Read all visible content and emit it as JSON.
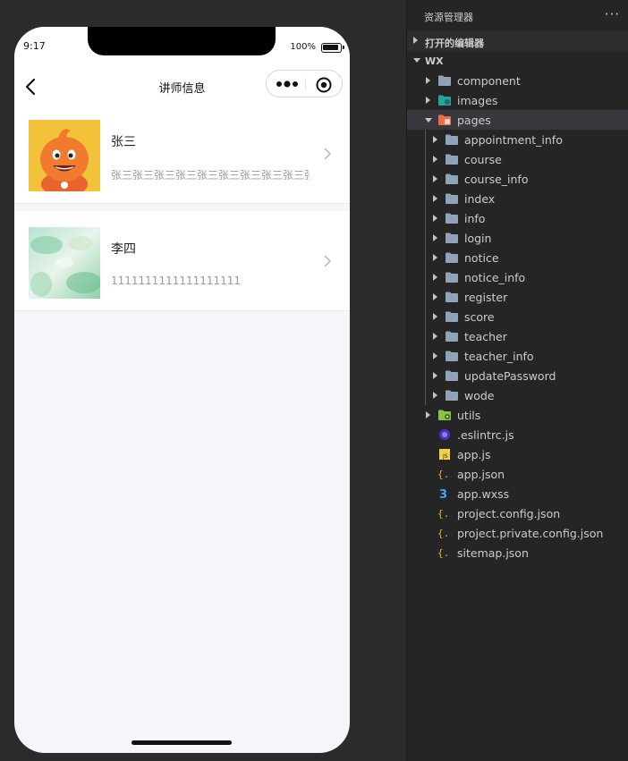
{
  "phone": {
    "status": {
      "time": "9:17",
      "battery": "100%"
    },
    "nav": {
      "title": "讲师信息"
    },
    "teachers": [
      {
        "name": "张三",
        "description": "张三张三张三张三张三张三张三张三张三张三张三"
      },
      {
        "name": "李四",
        "description": "1111111111111111111"
      }
    ]
  },
  "explorer": {
    "title": "资源管理器",
    "more": "···",
    "open_editors": "打开的编辑器",
    "root": "WX",
    "items": [
      {
        "label": "component",
        "icon": "folder-icon",
        "kind": "folder",
        "depth": 1,
        "open": false
      },
      {
        "label": "images",
        "icon": "images-folder-icon",
        "kind": "folder",
        "depth": 1,
        "open": false
      },
      {
        "label": "pages",
        "icon": "pages-folder-icon",
        "kind": "folder",
        "depth": 1,
        "open": true,
        "selected": true
      },
      {
        "label": "appointment_info",
        "icon": "folder-icon",
        "kind": "folder",
        "depth": 2,
        "open": false
      },
      {
        "label": "course",
        "icon": "folder-icon",
        "kind": "folder",
        "depth": 2,
        "open": false
      },
      {
        "label": "course_info",
        "icon": "folder-icon",
        "kind": "folder",
        "depth": 2,
        "open": false
      },
      {
        "label": "index",
        "icon": "folder-icon",
        "kind": "folder",
        "depth": 2,
        "open": false
      },
      {
        "label": "info",
        "icon": "folder-icon",
        "kind": "folder",
        "depth": 2,
        "open": false
      },
      {
        "label": "login",
        "icon": "folder-icon",
        "kind": "folder",
        "depth": 2,
        "open": false
      },
      {
        "label": "notice",
        "icon": "folder-icon",
        "kind": "folder",
        "depth": 2,
        "open": false
      },
      {
        "label": "notice_info",
        "icon": "folder-icon",
        "kind": "folder",
        "depth": 2,
        "open": false
      },
      {
        "label": "register",
        "icon": "folder-icon",
        "kind": "folder",
        "depth": 2,
        "open": false
      },
      {
        "label": "score",
        "icon": "folder-icon",
        "kind": "folder",
        "depth": 2,
        "open": false
      },
      {
        "label": "teacher",
        "icon": "folder-icon",
        "kind": "folder",
        "depth": 2,
        "open": false
      },
      {
        "label": "teacher_info",
        "icon": "folder-icon",
        "kind": "folder",
        "depth": 2,
        "open": false
      },
      {
        "label": "updatePassword",
        "icon": "folder-icon",
        "kind": "folder",
        "depth": 2,
        "open": false
      },
      {
        "label": "wode",
        "icon": "folder-icon",
        "kind": "folder",
        "depth": 2,
        "open": false
      },
      {
        "label": "utils",
        "icon": "utils-folder-icon",
        "kind": "folder",
        "depth": 1,
        "open": false
      },
      {
        "label": ".eslintrc.js",
        "icon": "eslint-file-icon",
        "kind": "file",
        "depth": 1
      },
      {
        "label": "app.js",
        "icon": "js-file-icon",
        "kind": "file",
        "depth": 1
      },
      {
        "label": "app.json",
        "icon": "json-file-icon",
        "kind": "file",
        "depth": 1
      },
      {
        "label": "app.wxss",
        "icon": "css-file-icon",
        "kind": "file",
        "depth": 1
      },
      {
        "label": "project.config.json",
        "icon": "json-file-icon",
        "kind": "file",
        "depth": 1
      },
      {
        "label": "project.private.config.json",
        "icon": "json-file-icon",
        "kind": "file",
        "depth": 1
      },
      {
        "label": "sitemap.json",
        "icon": "json-file-icon",
        "kind": "file",
        "depth": 1
      }
    ]
  },
  "colors": {
    "folder": "#8fa4b8",
    "images_folder": "#26a69a",
    "pages_folder": "#ef6c4a",
    "utils_folder": "#8bc34a",
    "json": "#e6b422",
    "js": "#f5d142",
    "css": "#42a5f5",
    "eslint": "#4b32c3"
  }
}
